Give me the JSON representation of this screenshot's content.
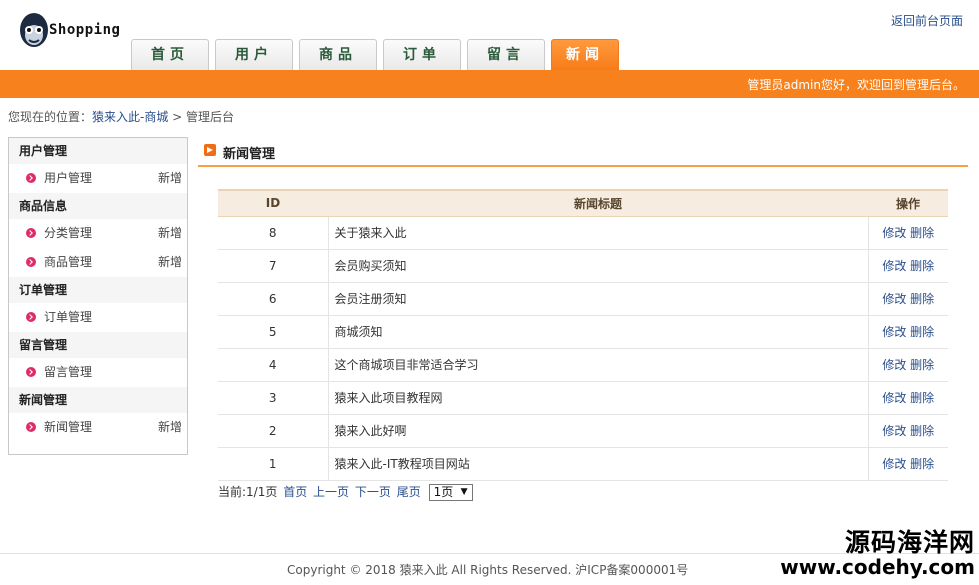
{
  "brand": {
    "logo_text": "Shopping",
    "logo_icon": "monkey-icon"
  },
  "header": {
    "front_link": "返回前台页面"
  },
  "nav": {
    "tabs": [
      {
        "label": "首页"
      },
      {
        "label": "用户"
      },
      {
        "label": "商品"
      },
      {
        "label": "订单"
      },
      {
        "label": "留言"
      },
      {
        "label": "新闻"
      }
    ],
    "active_index": 5
  },
  "banner": {
    "welcome": "管理员admin您好，欢迎回到管理后台。"
  },
  "breadcrumb": {
    "prefix": "您现在的位置：",
    "link": "猿来入此-商城",
    "sep": " > ",
    "current": "管理后台"
  },
  "sidebar": {
    "sections": [
      {
        "title": "用户管理",
        "items": [
          {
            "label": "用户管理",
            "extra": "新增"
          }
        ]
      },
      {
        "title": "商品信息",
        "items": [
          {
            "label": "分类管理",
            "extra": "新增"
          },
          {
            "label": "商品管理",
            "extra": "新增"
          }
        ]
      },
      {
        "title": "订单管理",
        "items": [
          {
            "label": "订单管理",
            "extra": ""
          }
        ]
      },
      {
        "title": "留言管理",
        "items": [
          {
            "label": "留言管理",
            "extra": ""
          }
        ]
      },
      {
        "title": "新闻管理",
        "items": [
          {
            "label": "新闻管理",
            "extra": "新增"
          }
        ]
      }
    ]
  },
  "panel": {
    "title": "新闻管理"
  },
  "table": {
    "headers": {
      "id": "ID",
      "title": "新闻标题",
      "action": "操作"
    },
    "actions": {
      "edit": "修改",
      "delete": "删除"
    },
    "rows": [
      {
        "id": "8",
        "title": "关于猿来入此"
      },
      {
        "id": "7",
        "title": "会员购买须知"
      },
      {
        "id": "6",
        "title": "会员注册须知"
      },
      {
        "id": "5",
        "title": "商城须知"
      },
      {
        "id": "4",
        "title": "这个商城项目非常适合学习"
      },
      {
        "id": "3",
        "title": "猿来入此项目教程网"
      },
      {
        "id": "2",
        "title": "猿来入此好啊"
      },
      {
        "id": "1",
        "title": "猿来入此-IT教程项目网站"
      }
    ]
  },
  "pager": {
    "status": "当前:1/1页",
    "first": "首页",
    "prev": "上一页",
    "next": "下一页",
    "last": "尾页",
    "select_value": "1页"
  },
  "footer": {
    "copyright": "Copyright © 2018 猿来入此 All Rights Reserved. 沪ICP备案000001号"
  },
  "watermark": {
    "line1": "源码海洋网",
    "line2": "www.codehy.com"
  }
}
